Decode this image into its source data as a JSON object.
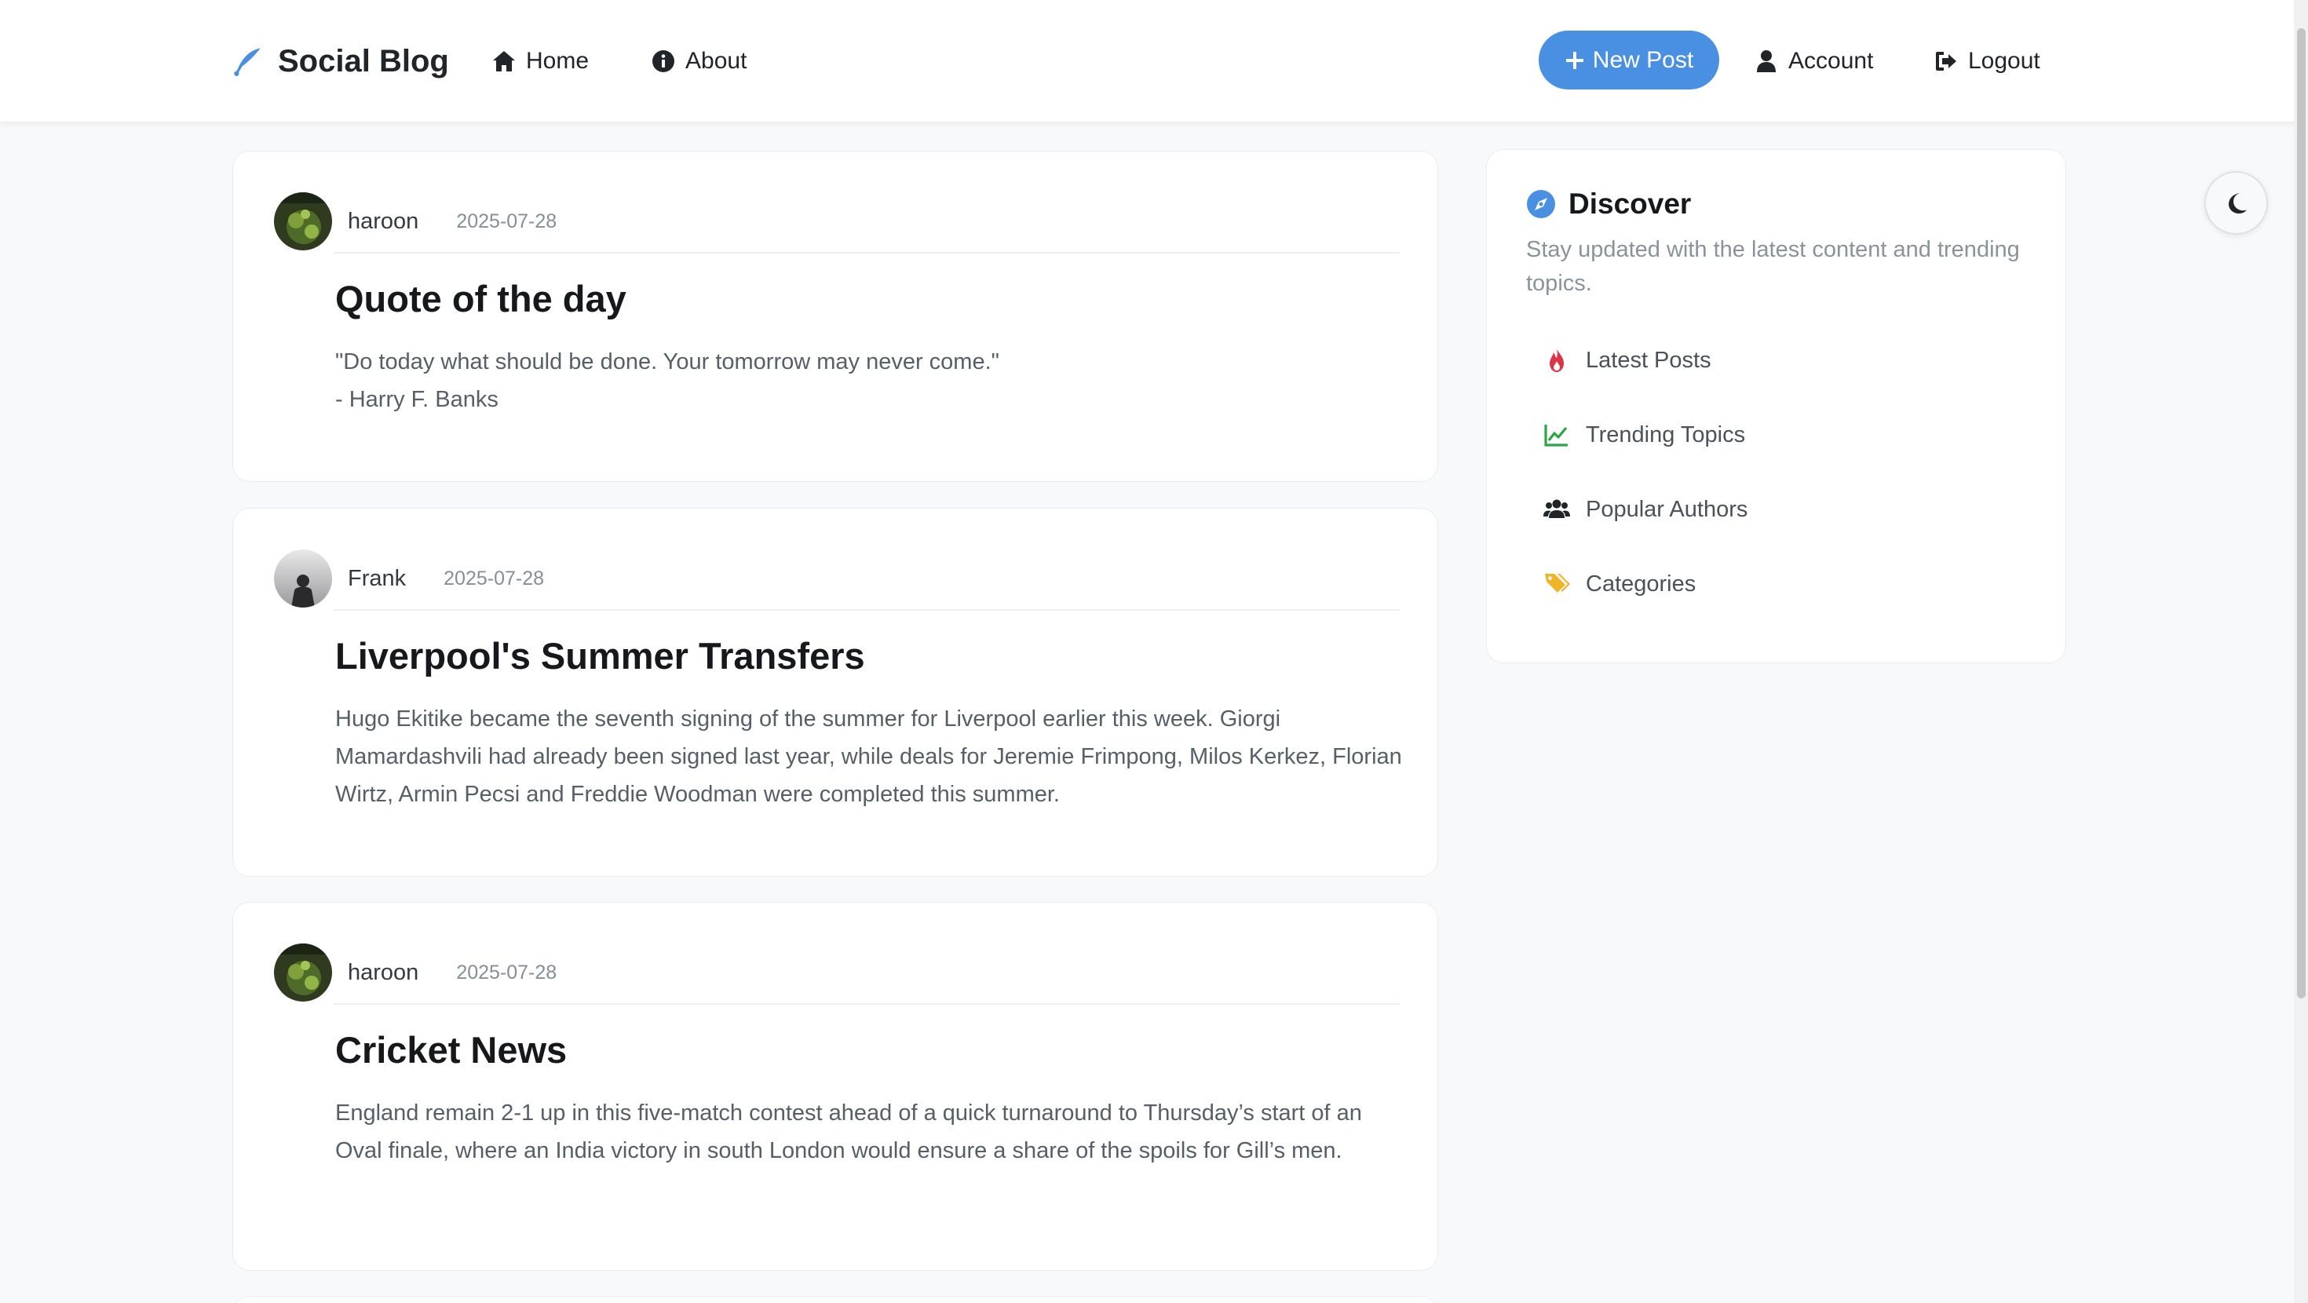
{
  "colors": {
    "accent": "#4a90e2",
    "flame": "#dc3545",
    "trend": "#28a745",
    "tag": "#f0b429"
  },
  "nav": {
    "brand": "Social Blog",
    "brand_icon": "feather-pen-icon",
    "home": "Home",
    "about": "About",
    "new_post": "New Post",
    "account": "Account",
    "logout": "Logout"
  },
  "posts": [
    {
      "author": "haroon",
      "date": "2025-07-28",
      "title": "Quote of the day",
      "body": "\"Do today what should be done. Your tomorrow may never come.\"\n- Harry F. Banks"
    },
    {
      "author": "Frank",
      "date": "2025-07-28",
      "title": "Liverpool's Summer Transfers",
      "body": "Hugo Ekitike became the seventh signing of the summer for Liverpool earlier this week. Giorgi Mamardashvili had already been signed last year, while deals for Jeremie Frimpong, Milos Kerkez, Florian Wirtz, Armin Pecsi and Freddie Woodman were completed this summer."
    },
    {
      "author": "haroon",
      "date": "2025-07-28",
      "title": "Cricket News",
      "body": "England remain 2-1 up in this five-match contest ahead of a quick turnaround to Thursday’s start of an Oval finale, where an India victory in south London would ensure a share of the spoils for Gill’s men."
    }
  ],
  "sidebar": {
    "title": "Discover",
    "description": "Stay updated with the latest content and trending topics.",
    "items": [
      {
        "label": "Latest Posts",
        "icon": "fire-icon"
      },
      {
        "label": "Trending Topics",
        "icon": "chart-line-icon"
      },
      {
        "label": "Popular Authors",
        "icon": "users-icon"
      },
      {
        "label": "Categories",
        "icon": "tags-icon"
      }
    ]
  },
  "theme_toggle": {
    "icon": "moon-icon"
  }
}
